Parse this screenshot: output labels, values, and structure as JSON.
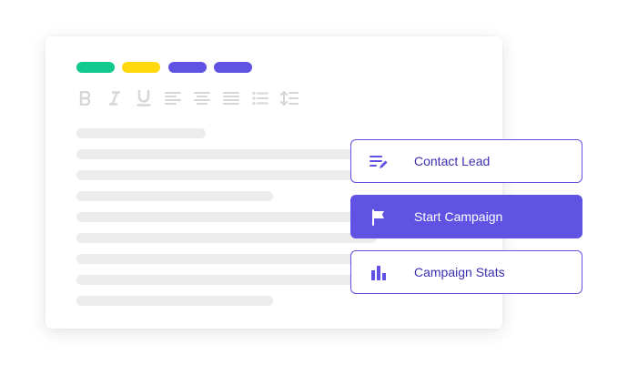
{
  "colors": {
    "accent": "#6052e3",
    "tag_green": "#12c98e",
    "tag_yellow": "#ffd80d",
    "tag_purple": "#6052e3",
    "toolbar_icon": "#d6d6d6",
    "text_placeholder": "#ececec"
  },
  "editor": {
    "tags": [
      "green-tag",
      "yellow-tag",
      "purple-tag",
      "purple-tag"
    ],
    "toolbar": [
      "bold-icon",
      "italic-icon",
      "underline-icon",
      "align-left-icon",
      "align-center-icon",
      "align-justify-icon",
      "bullet-list-icon",
      "line-height-icon"
    ],
    "text_lines": 9
  },
  "actions": [
    {
      "label": "Contact Lead",
      "icon": "edit-list-icon",
      "selected": false
    },
    {
      "label": "Start Campaign",
      "icon": "flag-icon",
      "selected": true
    },
    {
      "label": "Campaign Stats",
      "icon": "bar-chart-icon",
      "selected": false
    }
  ]
}
